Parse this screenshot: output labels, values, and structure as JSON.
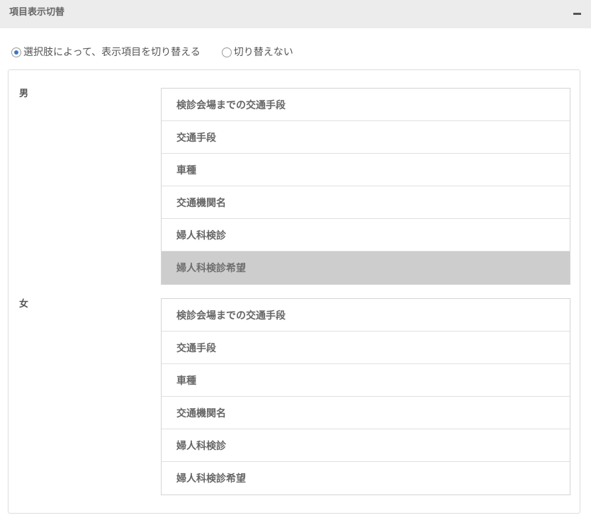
{
  "panel": {
    "title": "項目表示切替",
    "collapse_icon": "minus-icon"
  },
  "display_mode": {
    "options": [
      {
        "label": "選択肢によって、表示項目を切り替える",
        "checked": true
      },
      {
        "label": "切り替えない",
        "checked": false
      }
    ]
  },
  "groups": [
    {
      "label": "男",
      "items": [
        {
          "label": "検診会場までの交通手段",
          "selected": false
        },
        {
          "label": "交通手段",
          "selected": false
        },
        {
          "label": "車種",
          "selected": false
        },
        {
          "label": "交通機関名",
          "selected": false
        },
        {
          "label": "婦人科検診",
          "selected": false
        },
        {
          "label": "婦人科検診希望",
          "selected": true
        }
      ]
    },
    {
      "label": "女",
      "items": [
        {
          "label": "検診会場までの交通手段",
          "selected": false
        },
        {
          "label": "交通手段",
          "selected": false
        },
        {
          "label": "車種",
          "selected": false
        },
        {
          "label": "交通機関名",
          "selected": false
        },
        {
          "label": "婦人科検診",
          "selected": false
        },
        {
          "label": "婦人科検診希望",
          "selected": false
        }
      ]
    }
  ],
  "colors": {
    "header_bg": "#ececec",
    "radio_accent": "#3b78c4",
    "selected_item_bg": "#cdcdcd"
  }
}
